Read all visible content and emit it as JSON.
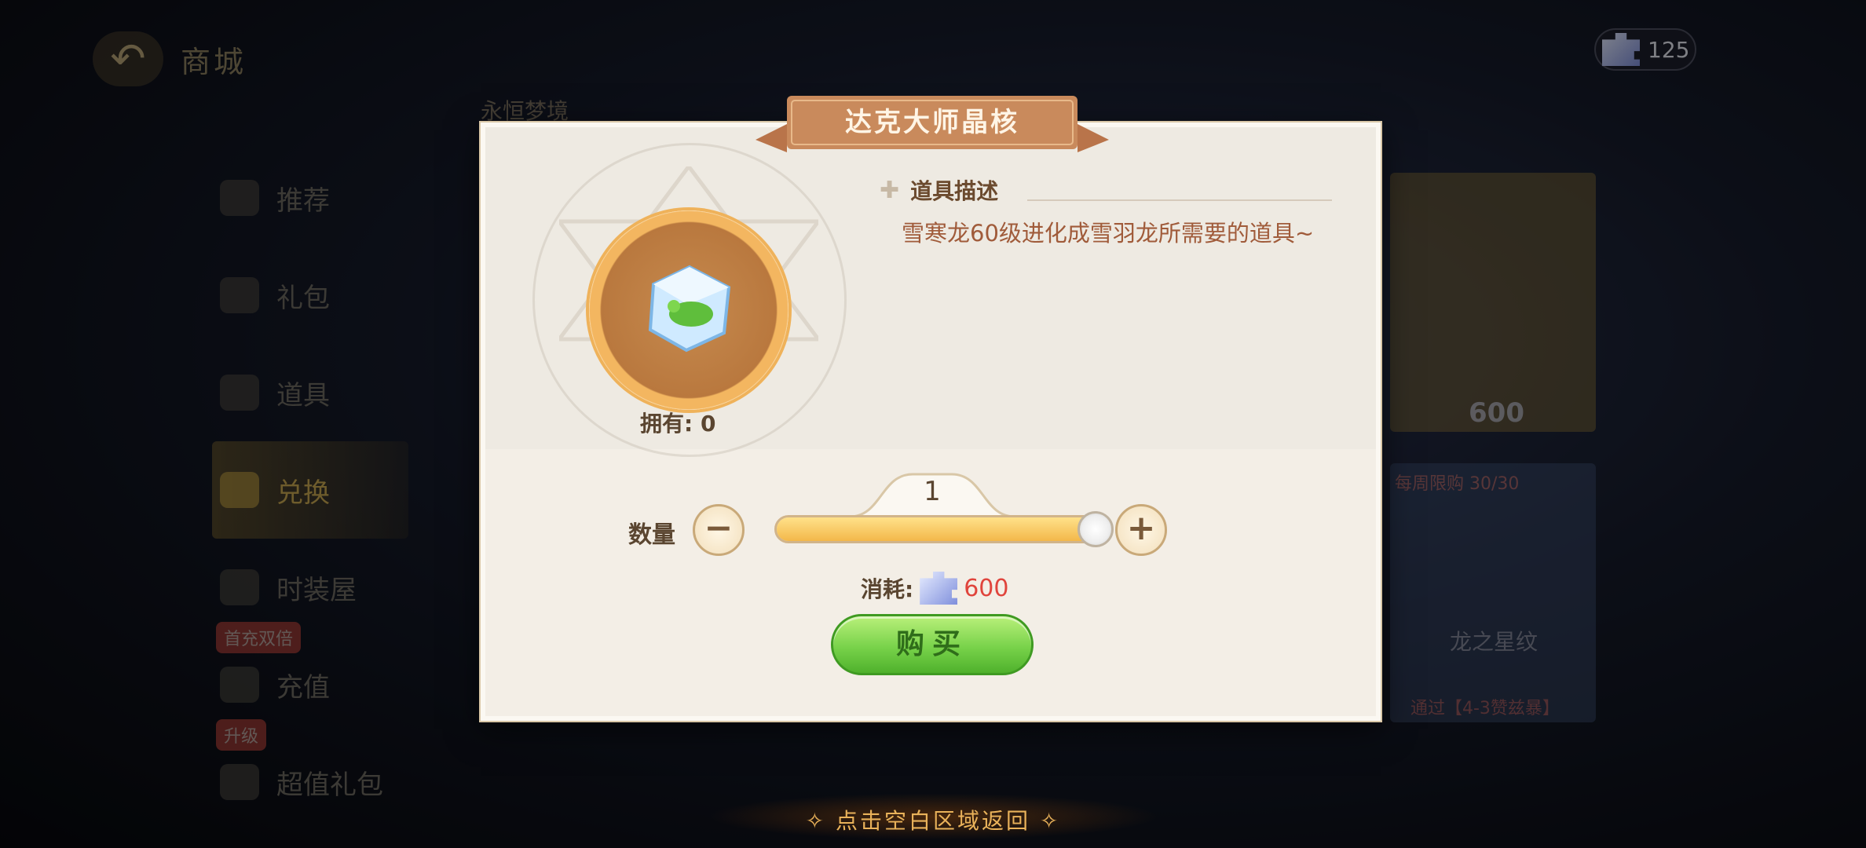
{
  "top_nav": {
    "shop_title": "商城",
    "section_title": "永恒梦境"
  },
  "sidebar": {
    "items": [
      {
        "label": "推荐",
        "icon": "thumbs-up-icon"
      },
      {
        "label": "礼包",
        "icon": "gift-icon"
      },
      {
        "label": "道具",
        "icon": "bag-icon"
      },
      {
        "label": "兑换",
        "icon": "exchange-icon",
        "active": true
      },
      {
        "label": "时装屋",
        "icon": "wardrobe-icon"
      },
      {
        "label": "充值",
        "icon": "coin-icon",
        "badge": "首充双倍"
      },
      {
        "label": "超值礼包",
        "icon": "gift-box-icon",
        "badge": "升级"
      }
    ]
  },
  "currency": {
    "icon": "puzzle-icon",
    "amount": "125"
  },
  "background_cards": {
    "card1_price": "600",
    "card2_badge": "每周限购 30/30",
    "card2_name": "龙之星纹",
    "card2_cond": "通过【4-3赞兹暴】"
  },
  "dialog": {
    "title": "达克大师晶核",
    "owned_label": "拥有: 0",
    "description_heading": "道具描述",
    "description_text": "雪寒龙60级进化成雪羽龙所需要的道具~",
    "quantity_label": "数量",
    "quantity_value": "1",
    "quantity_fraction": 1.0,
    "minus_label": "−",
    "plus_label": "+",
    "cost_label": "消耗:",
    "cost_value": "600",
    "buy_label": "购买"
  },
  "footer": {
    "close_hint": "✧ 点击空白区域返回 ✧"
  },
  "colors": {
    "accent_gold": "#f3b84a",
    "buy_green": "#78d24a",
    "cost_red": "#e0443c",
    "description_brown": "#a05b3a"
  }
}
